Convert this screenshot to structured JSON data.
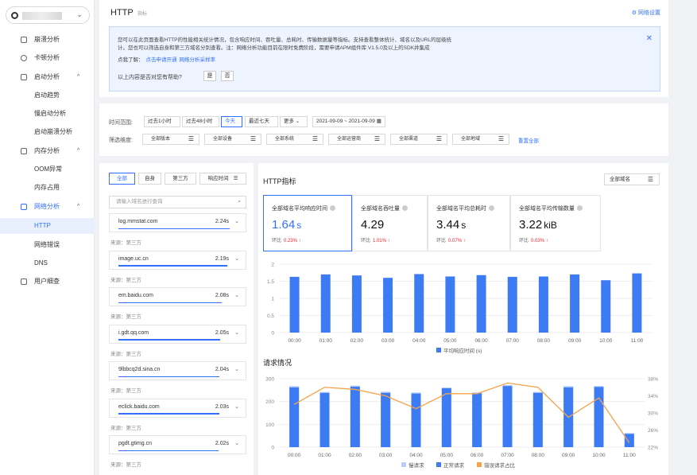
{
  "sidebar": {
    "items": [
      {
        "label": "崩溃分析",
        "icon": "crash-icon",
        "expand": ""
      },
      {
        "label": "卡顿分析",
        "icon": "lag-icon",
        "expand": ""
      },
      {
        "label": "启动分析",
        "icon": "launch-icon",
        "expand": "^"
      },
      {
        "label": "启动趋势"
      },
      {
        "label": "慢启动分析"
      },
      {
        "label": "启动崩溃分析"
      },
      {
        "label": "内存分析",
        "icon": "memory-icon",
        "expand": "^"
      },
      {
        "label": "OOM异常"
      },
      {
        "label": "内存占用"
      },
      {
        "label": "网络分析",
        "icon": "network-icon",
        "expand": "^"
      },
      {
        "label": "HTTP"
      },
      {
        "label": "网络错误"
      },
      {
        "label": "DNS"
      },
      {
        "label": "用户细查",
        "icon": "user-icon",
        "expand": ""
      }
    ]
  },
  "header": {
    "title": "HTTP",
    "tag": "指标",
    "settings": "网络设置"
  },
  "info": {
    "line1": "您可以在此页面查看HTTP的性能相关统计情况，包含响应时间、吞吐量、总耗时、传输数据量等指标。支持查看整体统计、域名以及URL的层级统",
    "line2": "计。您也可以筛选自身和第三方域名分别查看。注：网络分析功能目前在限时免费阶段，需要申请APM组件库 V1.5.0及以上的SDK并集成",
    "line3": "点我了解：",
    "link1": "点击申请开通",
    "link2": "网络分析采样率",
    "question": "以上内容是否对您有帮助?",
    "yes": "是",
    "no": "否"
  },
  "filter": {
    "time_label": "时间范围:",
    "time_buttons": [
      "过去1小时",
      "过去48小时",
      "今天",
      "最近七天",
      "更多 ⌄"
    ],
    "selected_time": "今天",
    "date_range": "2021-09-09 ~ 2021-09-09",
    "dim_label": "筛选维度:",
    "dims": [
      "全部版本",
      "全部设备",
      "全部系统",
      "全部运营商",
      "全部渠道",
      "全部地域"
    ],
    "reset": "重置全部"
  },
  "left": {
    "tabs": [
      "全部",
      "自身",
      "第三方",
      "响应时间"
    ],
    "search_placeholder": "请输入域名进行查询",
    "domains": [
      {
        "name": "log.mmstat.com",
        "value": "2.24s",
        "bar": 1.0,
        "source": "来源：第三方"
      },
      {
        "name": "image.uc.cn",
        "value": "2.19s",
        "bar": 0.98,
        "source": "来源：第三方"
      },
      {
        "name": "em.baidu.com",
        "value": "2.08s",
        "bar": 0.93,
        "source": "来源：第三方"
      },
      {
        "name": "i.gdt.qq.com",
        "value": "2.05s",
        "bar": 0.915,
        "source": "来源：第三方"
      },
      {
        "name": "9lbbcq2d.sina.cn",
        "value": "2.04s",
        "bar": 0.91,
        "source": "来源：第三方"
      },
      {
        "name": "eclick.baidu.com",
        "value": "2.03s",
        "bar": 0.906,
        "source": "来源：第三方"
      },
      {
        "name": "pgdt.gtimg.cn",
        "value": "2.02s",
        "bar": 0.9,
        "source": "来源：第三方"
      }
    ]
  },
  "right": {
    "title": "HTTP指标",
    "domain_select": "全部域名",
    "cards": [
      {
        "label": "全部域名平均响应时间",
        "value": "1.64",
        "unit": "s",
        "cmp": "环比",
        "change": "0.23%"
      },
      {
        "label": "全部域名吞吐量",
        "value": "4.29",
        "unit": "",
        "cmp": "环比",
        "change": "1.01%"
      },
      {
        "label": "全部域名平均总耗时",
        "value": "3.44",
        "unit": "s",
        "cmp": "环比",
        "change": "0.07%"
      },
      {
        "label": "全部域名平均传输数量",
        "value": "3.22",
        "unit": "kiB",
        "cmp": "环比",
        "change": "0.03%"
      }
    ],
    "req_title": "请求情况"
  },
  "chart_data": [
    {
      "type": "bar",
      "categories": [
        "00:00",
        "01:00",
        "02:00",
        "03:00",
        "04:00",
        "05:00",
        "06:00",
        "07:00",
        "08:00",
        "09:00",
        "10:00",
        "11:00"
      ],
      "series": [
        {
          "name": "平均响应时间 (s)",
          "values": [
            1.63,
            1.7,
            1.67,
            1.6,
            1.71,
            1.64,
            1.68,
            1.63,
            1.64,
            1.7,
            1.53,
            1.73
          ]
        }
      ],
      "ylim": [
        0,
        2
      ],
      "yticks": [
        "0",
        "0.5",
        "1",
        "1.5",
        "2"
      ],
      "color": "#3d7bf5"
    },
    {
      "type": "bar",
      "categories": [
        "00:00",
        "01:00",
        "02:00",
        "03:00",
        "04:00",
        "05:00",
        "06:00",
        "07:00",
        "08:00",
        "09:00",
        "10:00",
        "11:00"
      ],
      "series": [
        {
          "name": "慢请求",
          "values": [
            268,
            242,
            270,
            243,
            240,
            262,
            240,
            272,
            242,
            268,
            268,
            62
          ]
        },
        {
          "name": "正常请求",
          "values": [
            262,
            238,
            265,
            238,
            235,
            258,
            236,
            268,
            238,
            262,
            264,
            58
          ]
        },
        {
          "name": "错误请求占比",
          "values": [
            32,
            36,
            35.5,
            34,
            31,
            34.5,
            34.5,
            37,
            36,
            29,
            33.5,
            23
          ],
          "axis": "right"
        }
      ],
      "ylim": [
        0,
        300
      ],
      "yticks": [
        "0",
        "100",
        "200",
        "300"
      ],
      "y2lim": [
        22,
        38
      ],
      "y2ticks": [
        "22%",
        "26%",
        "30%",
        "34%",
        "38%"
      ],
      "colors": {
        "slow": "#b8cffa",
        "normal": "#3d7bf5",
        "error": "#f5a34a"
      }
    }
  ]
}
